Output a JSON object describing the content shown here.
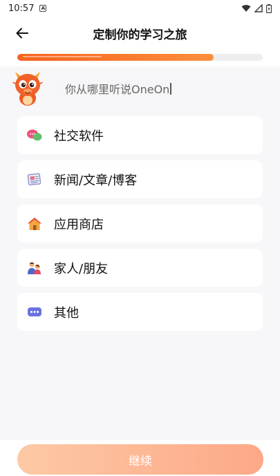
{
  "status_bar": {
    "time": "10:57",
    "notification_letter": "A"
  },
  "header": {
    "title": "定制你的学习之旅"
  },
  "progress": {
    "fraction": 0.8
  },
  "mascot": {
    "speech": "你从哪里听说OneOn"
  },
  "options": [
    {
      "label": "社交软件",
      "icon": "chat-bubbles-icon"
    },
    {
      "label": "新闻/文章/博客",
      "icon": "newspaper-icon"
    },
    {
      "label": "应用商店",
      "icon": "house-icon"
    },
    {
      "label": "家人/朋友",
      "icon": "family-icon"
    },
    {
      "label": "其他",
      "icon": "more-bubble-icon"
    }
  ],
  "footer": {
    "continue_label": "继续"
  },
  "colors": {
    "accent": "#f7631e",
    "button_start": "#fdc9a5",
    "button_end": "#fda887"
  }
}
